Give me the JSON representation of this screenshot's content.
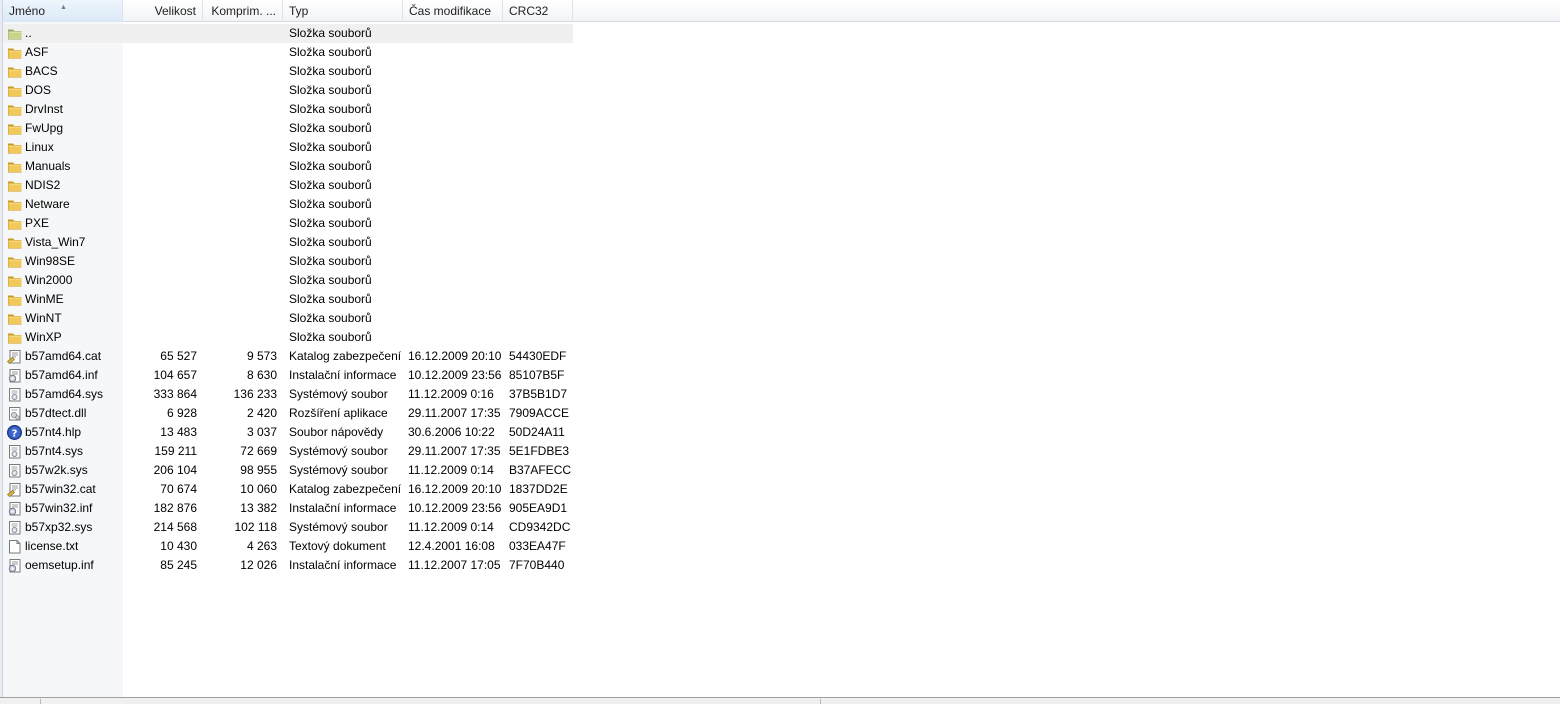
{
  "columns": {
    "name": "Jméno",
    "size": "Velikost",
    "compressed": "Komprim. ...",
    "type": "Typ",
    "modified": "Čas modifikace",
    "crc": "CRC32"
  },
  "sort": {
    "column": "name",
    "direction": "ascending"
  },
  "rows": [
    {
      "icon": "folder-up-icon",
      "name": "..",
      "size": "",
      "compressed": "",
      "type": "Složka souborů",
      "modified": "",
      "crc": ""
    },
    {
      "icon": "folder-icon",
      "name": "ASF",
      "size": "",
      "compressed": "",
      "type": "Složka souborů",
      "modified": "",
      "crc": ""
    },
    {
      "icon": "folder-icon",
      "name": "BACS",
      "size": "",
      "compressed": "",
      "type": "Složka souborů",
      "modified": "",
      "crc": ""
    },
    {
      "icon": "folder-icon",
      "name": "DOS",
      "size": "",
      "compressed": "",
      "type": "Složka souborů",
      "modified": "",
      "crc": ""
    },
    {
      "icon": "folder-icon",
      "name": "DrvInst",
      "size": "",
      "compressed": "",
      "type": "Složka souborů",
      "modified": "",
      "crc": ""
    },
    {
      "icon": "folder-icon",
      "name": "FwUpg",
      "size": "",
      "compressed": "",
      "type": "Složka souborů",
      "modified": "",
      "crc": ""
    },
    {
      "icon": "folder-icon",
      "name": "Linux",
      "size": "",
      "compressed": "",
      "type": "Složka souborů",
      "modified": "",
      "crc": ""
    },
    {
      "icon": "folder-icon",
      "name": "Manuals",
      "size": "",
      "compressed": "",
      "type": "Složka souborů",
      "modified": "",
      "crc": ""
    },
    {
      "icon": "folder-icon",
      "name": "NDIS2",
      "size": "",
      "compressed": "",
      "type": "Složka souborů",
      "modified": "",
      "crc": ""
    },
    {
      "icon": "folder-icon",
      "name": "Netware",
      "size": "",
      "compressed": "",
      "type": "Složka souborů",
      "modified": "",
      "crc": ""
    },
    {
      "icon": "folder-icon",
      "name": "PXE",
      "size": "",
      "compressed": "",
      "type": "Složka souborů",
      "modified": "",
      "crc": ""
    },
    {
      "icon": "folder-icon",
      "name": "Vista_Win7",
      "size": "",
      "compressed": "",
      "type": "Složka souborů",
      "modified": "",
      "crc": ""
    },
    {
      "icon": "folder-icon",
      "name": "Win98SE",
      "size": "",
      "compressed": "",
      "type": "Složka souborů",
      "modified": "",
      "crc": ""
    },
    {
      "icon": "folder-icon",
      "name": "Win2000",
      "size": "",
      "compressed": "",
      "type": "Složka souborů",
      "modified": "",
      "crc": ""
    },
    {
      "icon": "folder-icon",
      "name": "WinME",
      "size": "",
      "compressed": "",
      "type": "Složka souborů",
      "modified": "",
      "crc": ""
    },
    {
      "icon": "folder-icon",
      "name": "WinNT",
      "size": "",
      "compressed": "",
      "type": "Složka souborů",
      "modified": "",
      "crc": ""
    },
    {
      "icon": "folder-icon",
      "name": "WinXP",
      "size": "",
      "compressed": "",
      "type": "Složka souborů",
      "modified": "",
      "crc": ""
    },
    {
      "icon": "security-catalog-icon",
      "name": "b57amd64.cat",
      "size": "65 527",
      "compressed": "9 573",
      "type": "Katalog zabezpečení",
      "modified": "16.12.2009 20:10",
      "crc": "54430EDF"
    },
    {
      "icon": "setup-info-icon",
      "name": "b57amd64.inf",
      "size": "104 657",
      "compressed": "8 630",
      "type": "Instalační informace",
      "modified": "10.12.2009 23:56",
      "crc": "85107B5F"
    },
    {
      "icon": "system-file-icon",
      "name": "b57amd64.sys",
      "size": "333 864",
      "compressed": "136 233",
      "type": "Systémový soubor",
      "modified": "11.12.2009 0:16",
      "crc": "37B5B1D7"
    },
    {
      "icon": "dll-file-icon",
      "name": "b57dtect.dll",
      "size": "6 928",
      "compressed": "2 420",
      "type": "Rozšíření aplikace",
      "modified": "29.11.2007 17:35",
      "crc": "7909ACCE"
    },
    {
      "icon": "help-file-icon",
      "name": "b57nt4.hlp",
      "size": "13 483",
      "compressed": "3 037",
      "type": "Soubor nápovědy",
      "modified": "30.6.2006 10:22",
      "crc": "50D24A11"
    },
    {
      "icon": "system-file-icon",
      "name": "b57nt4.sys",
      "size": "159 211",
      "compressed": "72 669",
      "type": "Systémový soubor",
      "modified": "29.11.2007 17:35",
      "crc": "5E1FDBE3"
    },
    {
      "icon": "system-file-icon",
      "name": "b57w2k.sys",
      "size": "206 104",
      "compressed": "98 955",
      "type": "Systémový soubor",
      "modified": "11.12.2009 0:14",
      "crc": "B37AFECC"
    },
    {
      "icon": "security-catalog-icon",
      "name": "b57win32.cat",
      "size": "70 674",
      "compressed": "10 060",
      "type": "Katalog zabezpečení",
      "modified": "16.12.2009 20:10",
      "crc": "1837DD2E"
    },
    {
      "icon": "setup-info-icon",
      "name": "b57win32.inf",
      "size": "182 876",
      "compressed": "13 382",
      "type": "Instalační informace",
      "modified": "10.12.2009 23:56",
      "crc": "905EA9D1"
    },
    {
      "icon": "system-file-icon",
      "name": "b57xp32.sys",
      "size": "214 568",
      "compressed": "102 118",
      "type": "Systémový soubor",
      "modified": "11.12.2009 0:14",
      "crc": "CD9342DC"
    },
    {
      "icon": "text-file-icon",
      "name": "license.txt",
      "size": "10 430",
      "compressed": "4 263",
      "type": "Textový dokument",
      "modified": "12.4.2001 16:08",
      "crc": "033EA47F"
    },
    {
      "icon": "setup-info-icon",
      "name": "oemsetup.inf",
      "size": "85 245",
      "compressed": "12 026",
      "type": "Instalační informace",
      "modified": "11.12.2007 17:05",
      "crc": "7F70B440"
    }
  ],
  "colors": {
    "folder": "#e8c04a",
    "folder_dark": "#c99a1f",
    "help": "#2a4fb0",
    "selected_row": "#f0f0f0"
  }
}
